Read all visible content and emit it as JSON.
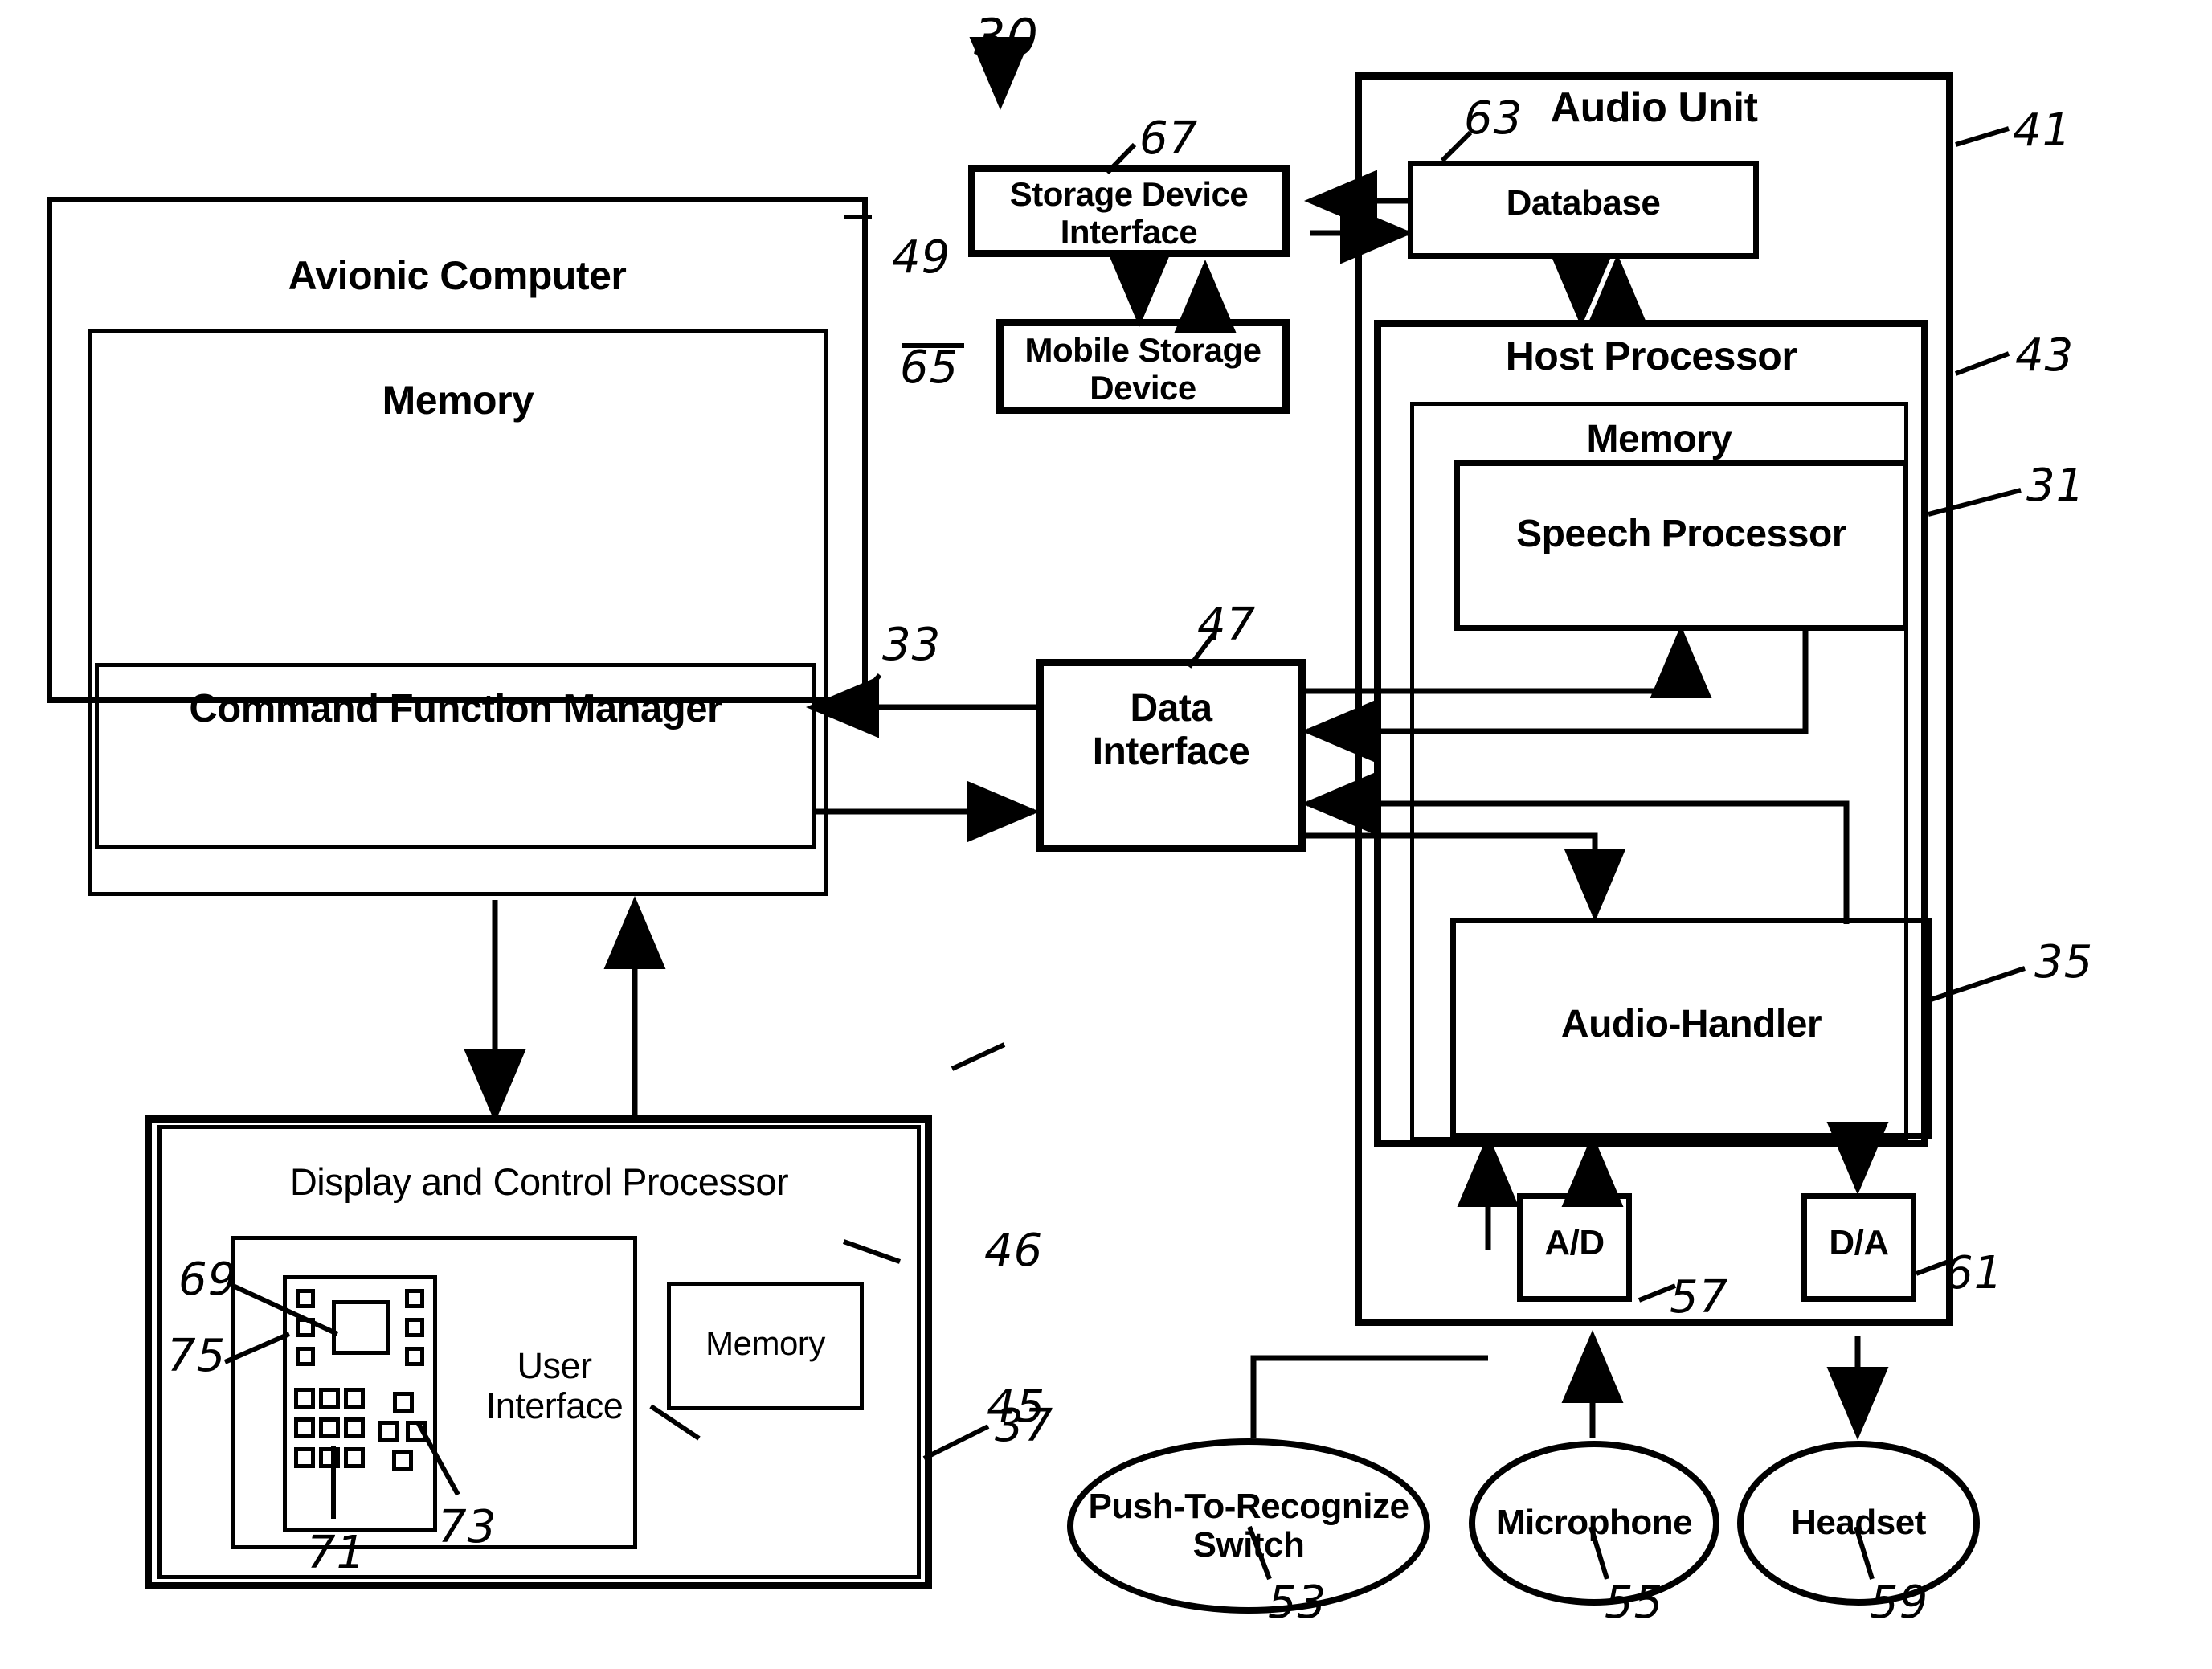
{
  "figure": {
    "system_ref": "30",
    "system_arrow": "↓"
  },
  "blocks": {
    "avionic_computer": {
      "label": "Avionic Computer",
      "ref": "49"
    },
    "avionic_memory": {
      "label": "Memory"
    },
    "command_function_manager": {
      "label": "Command Function Manager",
      "ref": "33"
    },
    "storage_device_interface": {
      "label": "Storage Device\nInterface",
      "ref": "67"
    },
    "mobile_storage_device": {
      "label": "Mobile Storage\nDevice",
      "ref": "65"
    },
    "data_interface": {
      "label": "Data\nInterface",
      "ref": "47"
    },
    "audio_unit": {
      "label": "Audio Unit",
      "ref": "41"
    },
    "database": {
      "label": "Database",
      "ref": "63"
    },
    "host_processor": {
      "label": "Host Processor",
      "ref": "43"
    },
    "host_memory": {
      "label": "Memory"
    },
    "speech_processor": {
      "label": "Speech Processor",
      "ref": "31"
    },
    "audio_handler": {
      "label": "Audio-Handler",
      "ref": "35"
    },
    "ad_converter": {
      "label": "A/D",
      "ref": "57"
    },
    "da_converter": {
      "label": "D/A",
      "ref": "61"
    },
    "display_control_processor": {
      "label": "Display and Control Processor",
      "ref": "45"
    },
    "user_interface": {
      "label": "User\nInterface",
      "ref": "37"
    },
    "dcp_memory": {
      "label": "Memory",
      "ref": "46"
    },
    "keypad_panel": {
      "ref": "75"
    },
    "display_screen": {
      "ref": "69"
    },
    "key_group_left": {
      "ref": "71"
    },
    "key_group_right": {
      "ref": "73"
    }
  },
  "peripherals": [
    {
      "label": "Push-To-Recognize\nSwitch",
      "ref": "53"
    },
    {
      "label": "Microphone",
      "ref": "55"
    },
    {
      "label": "Headset",
      "ref": "59"
    }
  ],
  "colors": {
    "ink": "#000000",
    "paper": "#ffffff"
  }
}
